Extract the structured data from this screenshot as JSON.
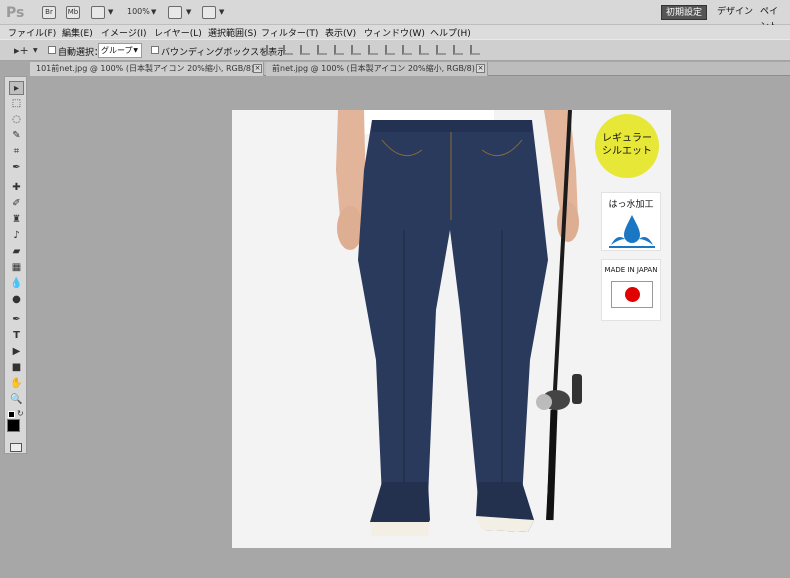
{
  "app": {
    "logo": "Ps",
    "zoom": "100%",
    "br_icon": "Br",
    "mb_icon": "Mb"
  },
  "workspace": {
    "items": [
      "初期設定",
      "デザイン",
      "ペイント"
    ]
  },
  "menu": [
    "ファイル(F)",
    "編集(E)",
    "イメージ(I)",
    "レイヤー(L)",
    "選択範囲(S)",
    "フィルター(T)",
    "表示(V)",
    "ウィンドウ(W)",
    "ヘルプ(H)"
  ],
  "options": {
    "auto_select_label": "自動選択：",
    "auto_select_value": "グループ",
    "bbox_label": "バウンディングボックスを表示"
  },
  "tabs": [
    {
      "label": "101前net.jpg @ 100% (日本製アイコン 20%縮小, RGB/8) *"
    },
    {
      "label": "前net.jpg @ 100% (日本製アイコン 20%縮小, RGB/8) *"
    }
  ],
  "image": {
    "badge_line1": "レギュラー",
    "badge_line2": "シルエット",
    "water_label": "はっ水加工",
    "made_label": "MADE IN JAPAN"
  },
  "colors": {
    "badge": "#e6e737",
    "denim": "#2a3a5c",
    "water_blue": "#1a77c4",
    "flag_red": "#e00000"
  }
}
